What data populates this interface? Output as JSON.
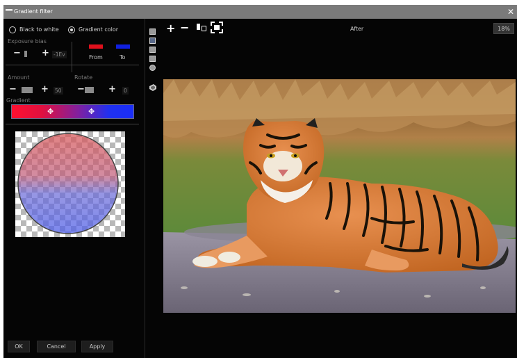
{
  "window": {
    "title": "Gradient filter",
    "close_glyph": "✕"
  },
  "mode": {
    "options": [
      {
        "label": "Black to white",
        "selected": false
      },
      {
        "label": "Gradient color",
        "selected": true
      }
    ]
  },
  "exposure_bias": {
    "label": "Exposure bias",
    "minus": "−",
    "plus": "+",
    "value": "-1Ev"
  },
  "colors": {
    "from": {
      "label": "From",
      "color": "#e0101c"
    },
    "to": {
      "label": "To",
      "color": "#1020e0"
    }
  },
  "amount": {
    "label": "Amount",
    "minus": "−",
    "plus": "+",
    "value": "50"
  },
  "rotate": {
    "label": "Rotate",
    "minus": "−",
    "plus": "+",
    "value": "0"
  },
  "gradient": {
    "label": "Gradient",
    "stop_glyph": "✥",
    "start_color": "#ff1030",
    "end_color": "#1a2ef8"
  },
  "buttons": {
    "ok": "OK",
    "cancel": "Cancel",
    "apply": "Apply"
  },
  "toolbar": {
    "zoom_in": "+",
    "zoom_out": "−",
    "view_label": "After",
    "zoom_level": "18%"
  },
  "side_tools": [
    "view-mode-1-icon",
    "view-mode-2-icon",
    "view-mode-3-icon",
    "view-mode-4-icon",
    "view-mode-5-icon",
    "stamp-icon"
  ]
}
